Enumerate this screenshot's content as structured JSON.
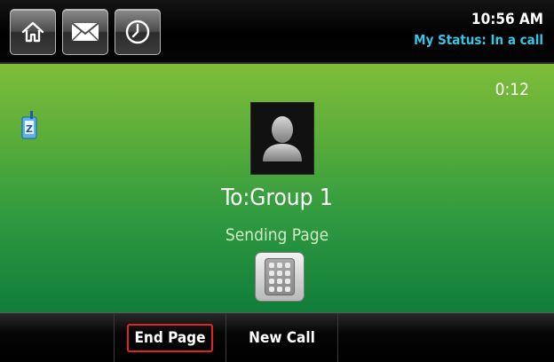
{
  "topbar": {
    "buttons": [
      {
        "icon": "home-icon"
      },
      {
        "icon": "envelope-icon"
      },
      {
        "icon": "clock-icon"
      }
    ],
    "time": "10:56 AM",
    "status": "My Status: In a call"
  },
  "call": {
    "timer": "0:12",
    "line_icon": "line-key-icon",
    "avatar_icon": "person-silhouette-icon",
    "callee": "To:Group 1",
    "state": "Sending Page",
    "dialpad_icon": "dialpad-icon"
  },
  "softkeys": {
    "end_page": "End Page",
    "new_call": "New Call"
  },
  "colors": {
    "status_text": "#38c6e6",
    "highlight_border": "#e02323",
    "call_bg_top": "#7fbd39",
    "call_bg_bottom": "#107d3a"
  }
}
